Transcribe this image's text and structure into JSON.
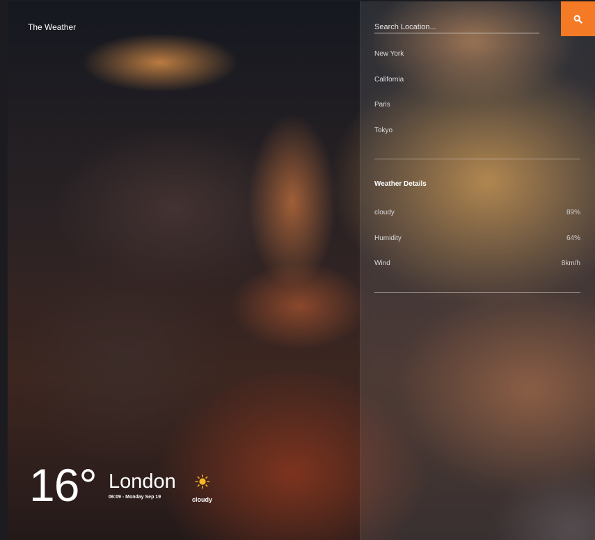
{
  "app": {
    "title": "The Weather"
  },
  "search": {
    "placeholder": "Search Location...",
    "button_icon": "search-icon",
    "accent": "#f47a25"
  },
  "locations": [
    "New York",
    "California",
    "Paris",
    "Tokyo"
  ],
  "details": {
    "title": "Weather Details",
    "rows": [
      {
        "label": "cloudy",
        "value": "89%"
      },
      {
        "label": "Humidity",
        "value": "64%"
      },
      {
        "label": "Wind",
        "value": "8km/h"
      }
    ]
  },
  "current": {
    "temperature": "16°",
    "city": "London",
    "datetime": "06:09 - Monday Sep 19",
    "condition": "cloudy",
    "condition_icon": "sun-icon"
  }
}
